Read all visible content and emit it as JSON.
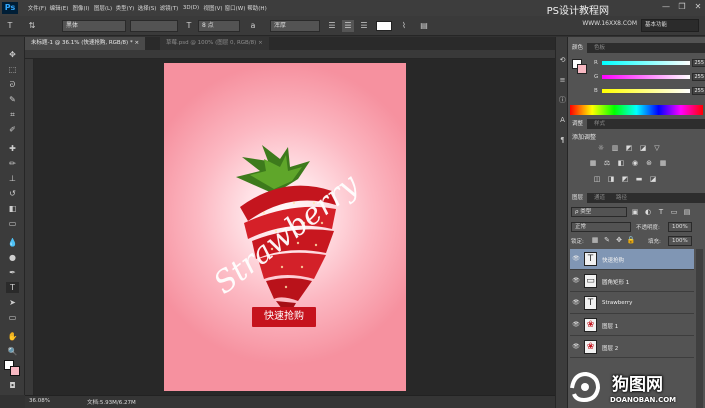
{
  "app": {
    "logo": "Ps",
    "brand_watermark": "PS设计教程网",
    "window_controls": [
      "—",
      "❐",
      "✕"
    ]
  },
  "menu": [
    "文件(F)",
    "编辑(E)",
    "图像(I)",
    "图层(L)",
    "类型(Y)",
    "选择(S)",
    "滤镜(T)",
    "3D(D)",
    "视图(V)",
    "窗口(W)",
    "帮助(H)"
  ],
  "options_bar": {
    "font_family": "黑体",
    "font_size": "8 点",
    "anti_alias": "浑厚",
    "nearby_site": "WWW.16XX8.COM",
    "workspace": "基本功能"
  },
  "tabs": [
    {
      "label": "未标题-1 @ 36.1% (快速抢购, RGB/8) *",
      "close": "×",
      "active": true
    },
    {
      "label": "草莓.psd @ 100% (图层 0, RGB/8)",
      "close": "×",
      "active": false
    }
  ],
  "tools": [
    "move-icon",
    "marquee-icon",
    "lasso-icon",
    "quick-select-icon",
    "crop-icon",
    "eyedropper-icon",
    "healing-icon",
    "brush-icon",
    "clone-stamp-icon",
    "history-brush-icon",
    "eraser-icon",
    "gradient-icon",
    "blur-icon",
    "dodge-icon",
    "pen-icon",
    "type-icon",
    "path-select-icon",
    "shape-icon",
    "hand-icon",
    "zoom-icon"
  ],
  "document": {
    "cta_text": "快速抢购",
    "script_text": "Strawberry",
    "background_colors": [
      "#fffafa",
      "#fcb8c2",
      "#f6919f"
    ],
    "cta_color": "#c6131d"
  },
  "status": {
    "zoom": "36.08%",
    "doc_info": "文档:5.93M/6.27M"
  },
  "color_panel": {
    "tabs": [
      "颜色",
      "色板"
    ],
    "channels": [
      {
        "label": "R",
        "value": "255"
      },
      {
        "label": "G",
        "value": "255"
      },
      {
        "label": "B",
        "value": "255"
      }
    ]
  },
  "adjustments_panel": {
    "tabs": [
      "调整",
      "样式"
    ],
    "title": "添加调整"
  },
  "layers_panel": {
    "tabs": [
      "图层",
      "通道",
      "路径"
    ],
    "kind_filter": "ρ 类型",
    "blend_mode": "正常",
    "opacity_label": "不透明度:",
    "opacity_value": "100%",
    "lock_label": "锁定:",
    "fill_label": "填充:",
    "fill_value": "100%",
    "layers": [
      {
        "name": "快速抢购",
        "thumb": "T",
        "selected": true
      },
      {
        "name": "圆角矩形 1",
        "thumb": "▭",
        "selected": false
      },
      {
        "name": "Strawberry",
        "thumb": "T",
        "selected": false
      },
      {
        "name": "图层 1",
        "thumb": "❀",
        "selected": false
      },
      {
        "name": "图层 2",
        "thumb": "❀",
        "selected": false
      }
    ]
  },
  "watermark": {
    "name": "狗图网",
    "url": "DOANOBAN.COM"
  }
}
